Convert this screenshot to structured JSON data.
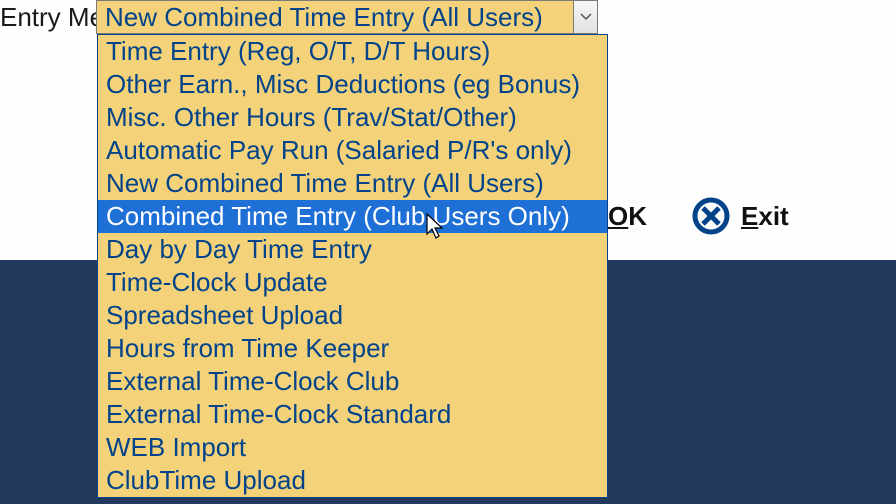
{
  "field": {
    "label": "Entry Method",
    "selected": "New Combined Time Entry (All Users)"
  },
  "dropdown": {
    "highlight_index": 5,
    "items": [
      "Time Entry (Reg, O/T, D/T Hours)",
      "Other Earn., Misc Deductions (eg Bonus)",
      "Misc. Other Hours (Trav/Stat/Other)",
      "Automatic Pay Run (Salaried P/R's only)",
      "New Combined Time Entry (All Users)",
      "Combined Time Entry  (Club Users Only)",
      "Day by Day Time Entry",
      "Time-Clock Update",
      "Spreadsheet Upload",
      "Hours from Time Keeper",
      "External Time-Clock Club",
      "External Time-Clock Standard",
      "WEB Import",
      "ClubTime Upload"
    ]
  },
  "buttons": {
    "ok_mnemonic": "O",
    "ok_rest": "K",
    "exit_mnemonic": "E",
    "exit_rest": "xit"
  },
  "colors": {
    "highlight": "#1e6fd6",
    "icon": "#034389"
  }
}
